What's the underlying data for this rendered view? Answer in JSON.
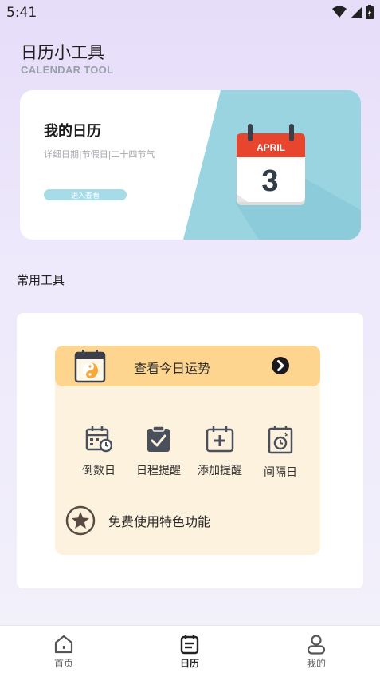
{
  "status_bar": {
    "time": "5:41"
  },
  "header": {
    "title": "日历小工具",
    "subtitle": "CALENDAR TOOL"
  },
  "banner": {
    "title": "我的日历",
    "description": "详细日期|节假日|二十四节气",
    "button_label": "进入查看",
    "calendar_month": "APRIL",
    "calendar_day": "3"
  },
  "section": {
    "title": "常用工具"
  },
  "fortune": {
    "label": "查看今日运势"
  },
  "tools": [
    {
      "label": "倒数日",
      "icon": "calendar-clock-icon"
    },
    {
      "label": "日程提醒",
      "icon": "clipboard-check-icon"
    },
    {
      "label": "添加提醒",
      "icon": "calendar-plus-icon"
    },
    {
      "label": "间隔日",
      "icon": "calendar-timer-icon"
    }
  ],
  "premium": {
    "label": "免费使用特色功能",
    "icon": "star-badge-icon"
  },
  "nav": [
    {
      "label": "首页",
      "icon": "home-icon"
    },
    {
      "label": "日历",
      "icon": "calendar-icon"
    },
    {
      "label": "我的",
      "icon": "user-icon"
    }
  ],
  "colors": {
    "accent_teal": "#a6dce8",
    "fortune_bar": "#fdd58f",
    "fortune_bg": "#fdf2dd",
    "calendar_red": "#e8452f"
  }
}
